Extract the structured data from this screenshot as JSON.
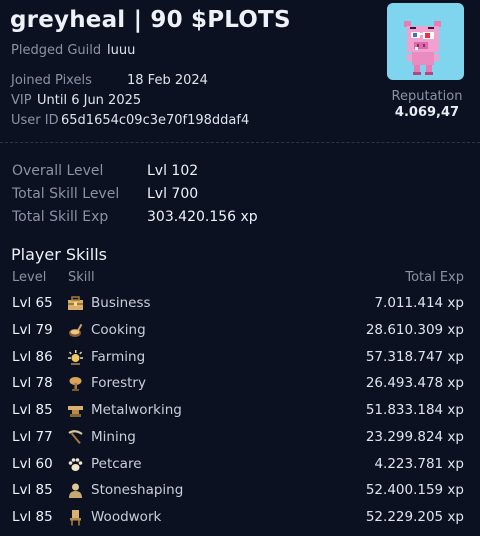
{
  "profile": {
    "title": "greyheal | 90 $PLOTS",
    "pledged_guild_label": "Pledged Guild",
    "pledged_guild_value": "luuu",
    "joined_label": "Joined Pixels",
    "joined_value": "18 Feb 2024",
    "vip_label": "VIP",
    "vip_value": "Until 6 Jun 2025",
    "user_id_label": "User ID",
    "user_id_value": "65d1654c09c3e70f198ddaf4",
    "reputation_label": "Reputation",
    "reputation_value": "4.069,47"
  },
  "stats": [
    {
      "label": "Overall Level",
      "value": "Lvl 102"
    },
    {
      "label": "Total Skill Level",
      "value": "Lvl 700"
    },
    {
      "label": "Total Skill Exp",
      "value": "303.420.156 xp"
    }
  ],
  "skills": {
    "title": "Player Skills",
    "headers": {
      "level": "Level",
      "skill": "Skill",
      "exp": "Total Exp"
    },
    "rows": [
      {
        "level": "Lvl 65",
        "name": "Business",
        "exp": "7.011.414 xp",
        "icon": "briefcase-icon"
      },
      {
        "level": "Lvl 79",
        "name": "Cooking",
        "exp": "28.610.309 xp",
        "icon": "pan-icon"
      },
      {
        "level": "Lvl 86",
        "name": "Farming",
        "exp": "57.318.747 xp",
        "icon": "sun-icon"
      },
      {
        "level": "Lvl 78",
        "name": "Forestry",
        "exp": "26.493.478 xp",
        "icon": "tree-icon"
      },
      {
        "level": "Lvl 85",
        "name": "Metalworking",
        "exp": "51.833.184 xp",
        "icon": "anvil-icon"
      },
      {
        "level": "Lvl 77",
        "name": "Mining",
        "exp": "23.299.824 xp",
        "icon": "pickaxe-icon"
      },
      {
        "level": "Lvl 60",
        "name": "Petcare",
        "exp": "4.223.781 xp",
        "icon": "paw-icon"
      },
      {
        "level": "Lvl 85",
        "name": "Stoneshaping",
        "exp": "52.400.159 xp",
        "icon": "bust-icon"
      },
      {
        "level": "Lvl 85",
        "name": "Woodwork",
        "exp": "52.229.205 xp",
        "icon": "chair-icon"
      }
    ]
  },
  "colors": {
    "background": "#0b1120",
    "avatar_bg": "#7fd4ee",
    "muted_text": "#8a93a6"
  }
}
